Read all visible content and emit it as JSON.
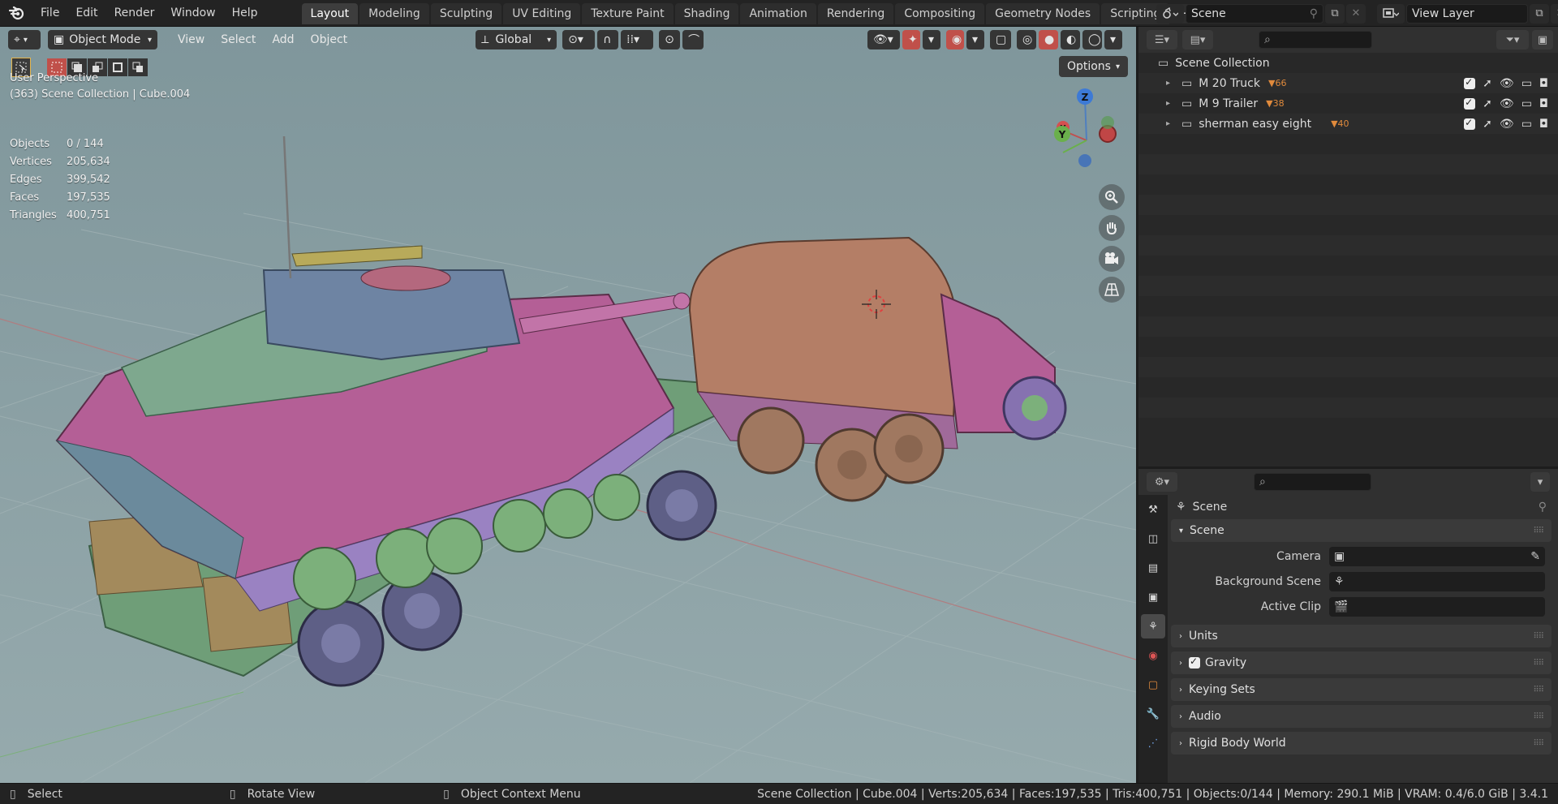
{
  "topbar": {
    "menus": [
      "File",
      "Edit",
      "Render",
      "Window",
      "Help"
    ],
    "workspaces": [
      "Layout",
      "Modeling",
      "Sculpting",
      "UV Editing",
      "Texture Paint",
      "Shading",
      "Animation",
      "Rendering",
      "Compositing",
      "Geometry Nodes",
      "Scripting"
    ],
    "active_workspace": "Layout",
    "scene_name": "Scene",
    "view_layer_name": "View Layer"
  },
  "viewport": {
    "mode": "Object Mode",
    "menus": [
      "View",
      "Select",
      "Add",
      "Object"
    ],
    "orientation": "Global",
    "options_label": "Options",
    "perspective": "User Perspective",
    "context": "(363) Scene Collection | Cube.004",
    "stats": [
      {
        "label": "Objects",
        "value": "0 / 144"
      },
      {
        "label": "Vertices",
        "value": "205,634"
      },
      {
        "label": "Edges",
        "value": "399,542"
      },
      {
        "label": "Faces",
        "value": "197,535"
      },
      {
        "label": "Triangles",
        "value": "400,751"
      }
    ],
    "gizmo": {
      "z": "Z",
      "y": "Y",
      "x": "X"
    }
  },
  "outliner": {
    "root": "Scene Collection",
    "items": [
      {
        "name": "M 20 Truck",
        "count": "66"
      },
      {
        "name": "M 9 Trailer",
        "count": "38"
      },
      {
        "name": "sherman easy eight",
        "count": "40"
      }
    ]
  },
  "properties": {
    "context_title": "Scene",
    "scene_panel": "Scene",
    "rows": [
      {
        "label": "Camera"
      },
      {
        "label": "Background Scene"
      },
      {
        "label": "Active Clip"
      }
    ],
    "collapsed_panels": [
      "Units",
      "Gravity",
      "Keying Sets",
      "Audio",
      "Rigid Body World"
    ]
  },
  "statusbar": {
    "select": "Select",
    "rotate": "Rotate View",
    "context_menu": "Object Context Menu",
    "info": "Scene Collection | Cube.004 | Verts:205,634 | Faces:197,535 | Tris:400,751 | Objects:0/144 | Memory: 290.1 MiB | VRAM: 0.4/6.0 GiB | 3.4.1"
  }
}
